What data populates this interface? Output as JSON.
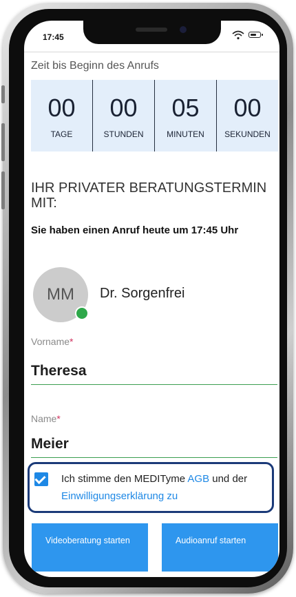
{
  "status_bar": {
    "time": "17:45"
  },
  "countdown": {
    "label": "Zeit bis Beginn des Anrufs",
    "units": [
      {
        "value": "00",
        "label": "TAGE"
      },
      {
        "value": "00",
        "label": "STUNDEN"
      },
      {
        "value": "05",
        "label": "MINUTEN"
      },
      {
        "value": "00",
        "label": "SEKUNDEN"
      }
    ]
  },
  "appointment": {
    "heading": "IHR PRIVATER BERATUNGSTERMIN MIT:",
    "subheading": "Sie haben einen Anruf heute um 17:45 Uhr"
  },
  "doctor": {
    "initials": "MM",
    "name": "Dr. Sorgenfrei",
    "status_color": "#2ea84a"
  },
  "form": {
    "first_name": {
      "label": "Vorname",
      "required_mark": "*",
      "value": "Theresa"
    },
    "last_name": {
      "label": "Name",
      "required_mark": "*",
      "value": "Meier"
    }
  },
  "consent": {
    "checked": true,
    "text_before": "Ich stimme den MEDITyme ",
    "agb_link": "AGB",
    "text_middle": " und der ",
    "consent_link": "Einwilligungserklärung zu"
  },
  "buttons": {
    "video": "Videoberatung starten",
    "audio": "Audioanruf starten"
  },
  "colors": {
    "accent": "#2e96ee",
    "link": "#1e88e5",
    "countdown_bg": "#e3eefa",
    "consent_border": "#1b3a78"
  }
}
